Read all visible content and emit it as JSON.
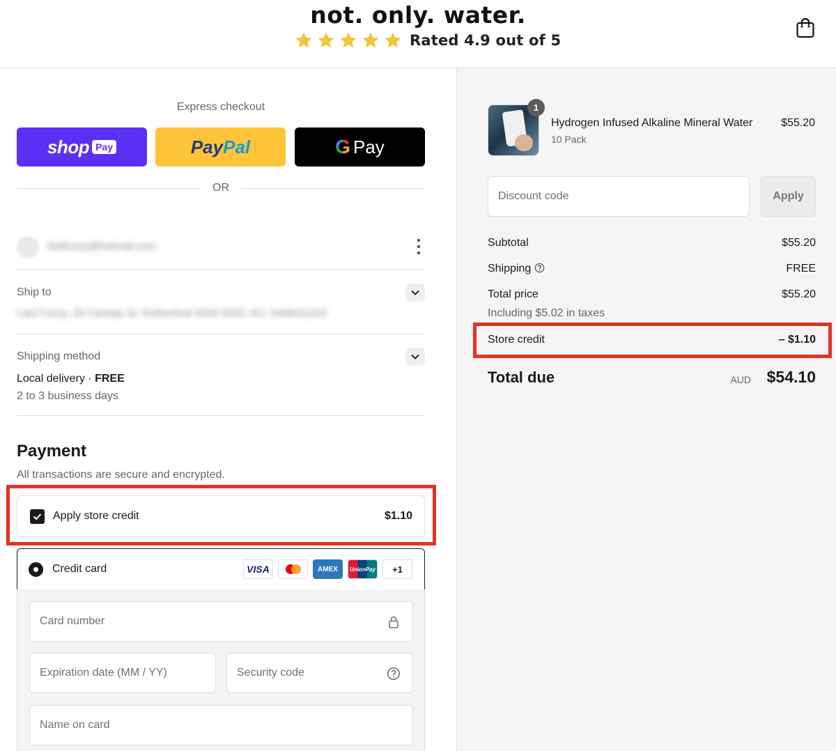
{
  "header": {
    "brand": "not. only. water.",
    "rating_text": "Rated 4.9 out of 5",
    "stars": 5,
    "star_color": "#f5c43c",
    "cart_icon": "shopping-bag-icon"
  },
  "express": {
    "title": "Express checkout",
    "shop_pay": {
      "logo": "shop",
      "badge": "Pay",
      "color": "#5a31f4"
    },
    "paypal": {
      "pay": "Pay",
      "pal": "Pal",
      "color": "#ffc439"
    },
    "gpay": {
      "g": "G",
      "label": "Pay",
      "color": "#000000"
    },
    "or_label": "OR"
  },
  "account": {
    "email": "fastfuzzy@hotmail.com",
    "menu_icon": "more-vertical-icon"
  },
  "ship_to": {
    "label": "Ship to",
    "address": "Last Fuzzy, 28 Fairway St, Rutherford NSW 5020, AU, 0406411153"
  },
  "shipping_method": {
    "label": "Shipping method",
    "name": "Local delivery",
    "separator": "·",
    "price": "FREE",
    "eta": "2 to 3 business days"
  },
  "payment": {
    "title": "Payment",
    "subtitle": "All transactions are secure and encrypted.",
    "store_credit": {
      "label": "Apply store credit",
      "amount": "$1.10",
      "checked": true
    },
    "credit_card": {
      "label": "Credit card",
      "selected": true,
      "logos": [
        "VISA",
        "Mastercard",
        "AMEX",
        "UnionPay",
        "+1"
      ],
      "logo_text": {
        "visa": "VISA",
        "amex": "AMEX",
        "unionpay": "UnionPay",
        "more": "+1"
      }
    },
    "fields": {
      "card_number": "Card number",
      "expiration": "Expiration date (MM / YY)",
      "security_code": "Security code",
      "name_on_card": "Name on card"
    }
  },
  "order": {
    "product": {
      "name": "Hydrogen Infused Alkaline Mineral Water",
      "variant": "10 Pack",
      "price": "$55.20",
      "quantity": "1"
    },
    "discount": {
      "placeholder": "Discount code",
      "apply_label": "Apply"
    },
    "subtotal": {
      "label": "Subtotal",
      "value": "$55.20"
    },
    "shipping": {
      "label": "Shipping",
      "value": "FREE"
    },
    "total_price": {
      "label": "Total price",
      "value": "$55.20"
    },
    "taxes_note": "Including $5.02 in taxes",
    "store_credit": {
      "label": "Store credit",
      "value": "– $1.10"
    },
    "total_due": {
      "label": "Total due",
      "currency": "AUD",
      "value": "$54.10"
    }
  },
  "colors": {
    "highlight": "#e53224",
    "summary_bg": "#f5f5f5"
  }
}
